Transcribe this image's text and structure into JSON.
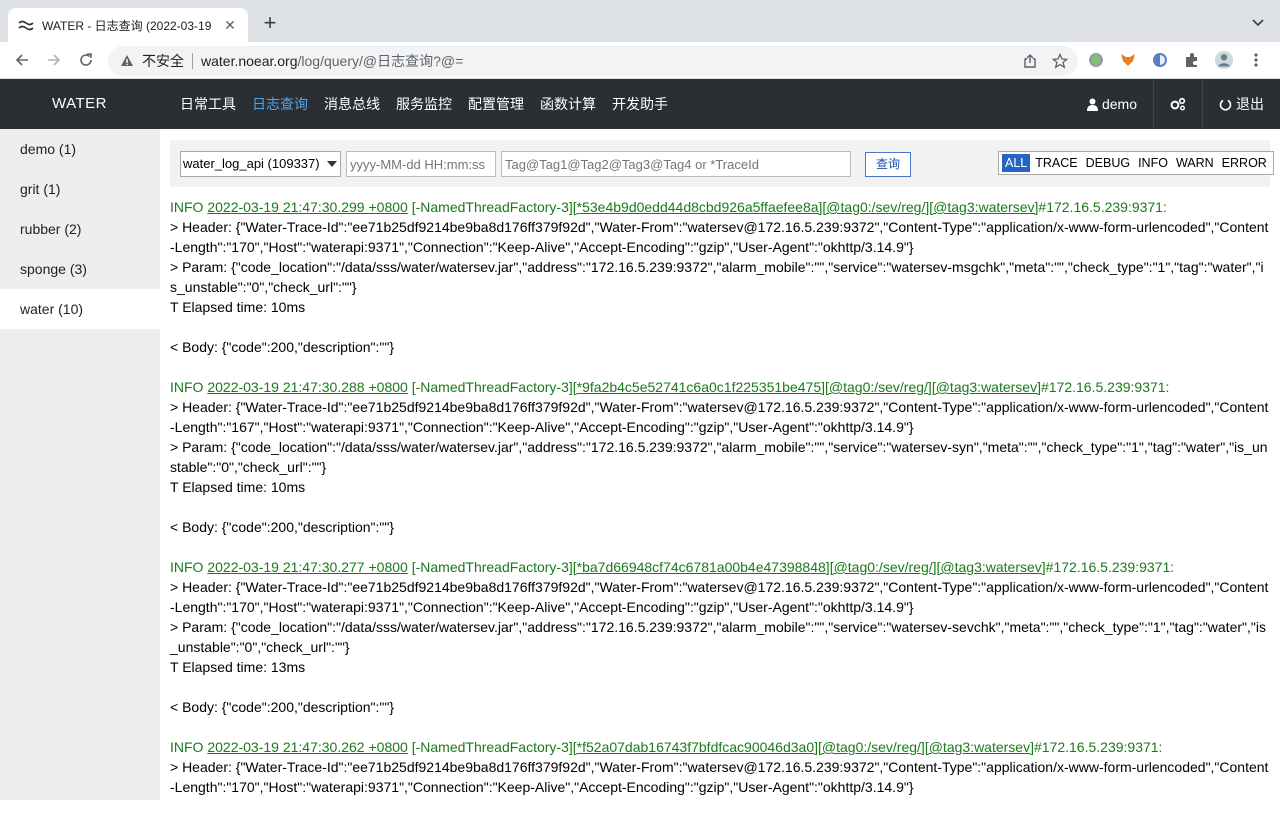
{
  "browser": {
    "tab_title": "WATER - 日志查询 (2022-03-19",
    "insecure_label": "不安全",
    "url_host": "water.noear.org",
    "url_path": "/log/query/@日志查询?@="
  },
  "app": {
    "logo": "WATER",
    "nav": [
      "日常工具",
      "日志查询",
      "消息总线",
      "服务监控",
      "配置管理",
      "函数计算",
      "开发助手"
    ],
    "active_nav": "日志查询",
    "user": "demo",
    "logout": "退出"
  },
  "sidebar": {
    "items": [
      {
        "label": "demo (1)"
      },
      {
        "label": "grit (1)"
      },
      {
        "label": "rubber (2)"
      },
      {
        "label": "sponge (3)"
      },
      {
        "label": "water (10)"
      }
    ],
    "active_index": 4
  },
  "filter": {
    "logger_select": "water_log_api (109337)",
    "date_placeholder": "yyyy-MM-dd HH:mm:ss",
    "tag_placeholder": "Tag@Tag1@Tag2@Tag3@Tag4 or *TraceId",
    "query_button": "查询",
    "levels": [
      "ALL",
      "TRACE",
      "DEBUG",
      "INFO",
      "WARN",
      "ERROR"
    ],
    "active_level": "ALL"
  },
  "logs": [
    {
      "level": "INFO",
      "time": "2022-03-19 21:47:30.299 +0800",
      "thread": "[-NamedThreadFactory-3]",
      "trace": "[*53e4b9d0edd44d8cbd926a5ffaefee8a]",
      "tag0": "[@tag0:/sev/reg/]",
      "tag3": "[@tag3:watersev]",
      "host": "#172.16.5.239:9371:",
      "header": "> Header: {\"Water-Trace-Id\":\"ee71b25df9214be9ba8d176ff379f92d\",\"Water-From\":\"watersev@172.16.5.239:9372\",\"Content-Type\":\"application/x-www-form-urlencoded\",\"Content-Length\":\"170\",\"Host\":\"waterapi:9371\",\"Connection\":\"Keep-Alive\",\"Accept-Encoding\":\"gzip\",\"User-Agent\":\"okhttp/3.14.9\"}",
      "param": "> Param: {\"code_location\":\"/data/sss/water/watersev.jar\",\"address\":\"172.16.5.239:9372\",\"alarm_mobile\":\"\",\"service\":\"watersev-msgchk\",\"meta\":\"\",\"check_type\":\"1\",\"tag\":\"water\",\"is_unstable\":\"0\",\"check_url\":\"\"}",
      "elapsed": "T Elapsed time: 10ms",
      "body": "< Body: {\"code\":200,\"description\":\"\"}"
    },
    {
      "level": "INFO",
      "time": "2022-03-19 21:47:30.288 +0800",
      "thread": "[-NamedThreadFactory-3]",
      "trace": "[*9fa2b4c5e52741c6a0c1f225351be475]",
      "tag0": "[@tag0:/sev/reg/]",
      "tag3": "[@tag3:watersev]",
      "host": "#172.16.5.239:9371:",
      "header": "> Header: {\"Water-Trace-Id\":\"ee71b25df9214be9ba8d176ff379f92d\",\"Water-From\":\"watersev@172.16.5.239:9372\",\"Content-Type\":\"application/x-www-form-urlencoded\",\"Content-Length\":\"167\",\"Host\":\"waterapi:9371\",\"Connection\":\"Keep-Alive\",\"Accept-Encoding\":\"gzip\",\"User-Agent\":\"okhttp/3.14.9\"}",
      "param": "> Param: {\"code_location\":\"/data/sss/water/watersev.jar\",\"address\":\"172.16.5.239:9372\",\"alarm_mobile\":\"\",\"service\":\"watersev-syn\",\"meta\":\"\",\"check_type\":\"1\",\"tag\":\"water\",\"is_unstable\":\"0\",\"check_url\":\"\"}",
      "elapsed": "T Elapsed time: 10ms",
      "body": "< Body: {\"code\":200,\"description\":\"\"}"
    },
    {
      "level": "INFO",
      "time": "2022-03-19 21:47:30.277 +0800",
      "thread": "[-NamedThreadFactory-3]",
      "trace": "[*ba7d66948cf74c6781a00b4e47398848]",
      "tag0": "[@tag0:/sev/reg/]",
      "tag3": "[@tag3:watersev]",
      "host": "#172.16.5.239:9371:",
      "header": "> Header: {\"Water-Trace-Id\":\"ee71b25df9214be9ba8d176ff379f92d\",\"Water-From\":\"watersev@172.16.5.239:9372\",\"Content-Type\":\"application/x-www-form-urlencoded\",\"Content-Length\":\"170\",\"Host\":\"waterapi:9371\",\"Connection\":\"Keep-Alive\",\"Accept-Encoding\":\"gzip\",\"User-Agent\":\"okhttp/3.14.9\"}",
      "param": "> Param: {\"code_location\":\"/data/sss/water/watersev.jar\",\"address\":\"172.16.5.239:9372\",\"alarm_mobile\":\"\",\"service\":\"watersev-sevchk\",\"meta\":\"\",\"check_type\":\"1\",\"tag\":\"water\",\"is_unstable\":\"0\",\"check_url\":\"\"}",
      "elapsed": "T Elapsed time: 13ms",
      "body": "< Body: {\"code\":200,\"description\":\"\"}"
    },
    {
      "level": "INFO",
      "time": "2022-03-19 21:47:30.262 +0800",
      "thread": "[-NamedThreadFactory-3]",
      "trace": "[*f52a07dab16743f7bfdfcac90046d3a0]",
      "tag0": "[@tag0:/sev/reg/]",
      "tag3": "[@tag3:watersev]",
      "host": "#172.16.5.239:9371:",
      "header": "> Header: {\"Water-Trace-Id\":\"ee71b25df9214be9ba8d176ff379f92d\",\"Water-From\":\"watersev@172.16.5.239:9372\",\"Content-Type\":\"application/x-www-form-urlencoded\",\"Content-Length\":\"170\",\"Host\":\"waterapi:9371\",\"Connection\":\"Keep-Alive\",\"Accept-Encoding\":\"gzip\",\"User-Agent\":\"okhttp/3.14.9\"}"
    }
  ],
  "colors": {
    "header_bg": "#2b2e33",
    "nav_active": "#4ea7e8",
    "log_green": "#1a7a1a",
    "level_active_bg": "#2563c9"
  }
}
